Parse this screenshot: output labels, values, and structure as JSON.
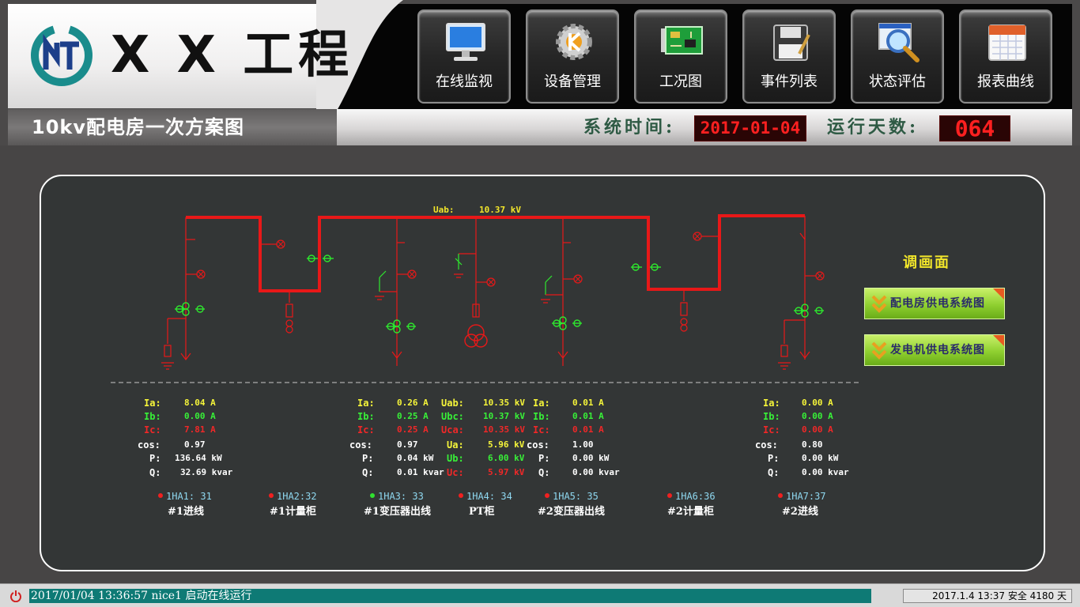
{
  "header": {
    "app_title": "X X 工程",
    "subtitle": "10kv配电房一次方案图",
    "system_time_label": "系统时间:",
    "system_time_value": "2017-01-04",
    "run_days_label": "运行天数:",
    "run_days_value": "064"
  },
  "nav": {
    "items": [
      {
        "label": "在线监视",
        "icon": "monitor-icon"
      },
      {
        "label": "设备管理",
        "icon": "gear-icon"
      },
      {
        "label": "工况图",
        "icon": "circuit-board-icon"
      },
      {
        "label": "事件列表",
        "icon": "floppy-disk-icon"
      },
      {
        "label": "状态评估",
        "icon": "magnifier-icon"
      },
      {
        "label": "报表曲线",
        "icon": "calendar-icon"
      }
    ]
  },
  "diagram": {
    "bus_label": "Uab:",
    "bus_value": "10.37 kV"
  },
  "feeders": [
    {
      "code": "1HA1: 31",
      "name": "#1进线",
      "status_color": "#f02020",
      "rows": [
        {
          "label": "Ia:",
          "value": "8.04 A",
          "color": "yellow"
        },
        {
          "label": "Ib:",
          "value": "0.00 A",
          "color": "green"
        },
        {
          "label": "Ic:",
          "value": "7.81 A",
          "color": "red"
        },
        {
          "label": "cos:",
          "value": "0.97",
          "color": "white"
        },
        {
          "label": "P:",
          "value": "136.64 kW",
          "color": "white"
        },
        {
          "label": "Q:",
          "value": "32.69 kvar",
          "color": "white"
        }
      ]
    },
    {
      "code": "1HA2:32",
      "name": "#1计量柜",
      "status_color": "#f02020",
      "rows": []
    },
    {
      "code": "1HA3: 33",
      "name": "#1变压器出线",
      "status_color": "#30e030",
      "rows": [
        {
          "label": "Ia:",
          "value": "0.26 A",
          "color": "yellow"
        },
        {
          "label": "Ib:",
          "value": "0.25 A",
          "color": "green"
        },
        {
          "label": "Ic:",
          "value": "0.25 A",
          "color": "red"
        },
        {
          "label": "cos:",
          "value": "0.97",
          "color": "white"
        },
        {
          "label": "P:",
          "value": "0.04 kW",
          "color": "white"
        },
        {
          "label": "Q:",
          "value": "0.01 kvar",
          "color": "white"
        }
      ]
    },
    {
      "code": "1HA4: 34",
      "name": "PT柜",
      "status_color": "#f02020",
      "rows": [
        {
          "label": "Uab:",
          "value": "10.35 kV",
          "color": "yellow"
        },
        {
          "label": "Ubc:",
          "value": "10.37 kV",
          "color": "green"
        },
        {
          "label": "Uca:",
          "value": "10.35 kV",
          "color": "red"
        },
        {
          "label": "Ua:",
          "value": "5.96 kV",
          "color": "yellow"
        },
        {
          "label": "Ub:",
          "value": "6.00 kV",
          "color": "green"
        },
        {
          "label": "Uc:",
          "value": "5.97 kV",
          "color": "red"
        }
      ]
    },
    {
      "code": "1HA5: 35",
      "name": "#2变压器出线",
      "status_color": "#f02020",
      "rows": [
        {
          "label": "Ia:",
          "value": "0.01 A",
          "color": "yellow"
        },
        {
          "label": "Ib:",
          "value": "0.01 A",
          "color": "green"
        },
        {
          "label": "Ic:",
          "value": "0.01 A",
          "color": "red"
        },
        {
          "label": "cos:",
          "value": "1.00",
          "color": "white"
        },
        {
          "label": "P:",
          "value": "0.00 kW",
          "color": "white"
        },
        {
          "label": "Q:",
          "value": "0.00 kvar",
          "color": "white"
        }
      ]
    },
    {
      "code": "1HA6:36",
      "name": "#2计量柜",
      "status_color": "#f02020",
      "rows": []
    },
    {
      "code": "1HA7:37",
      "name": "#2进线",
      "status_color": "#f02020",
      "rows": [
        {
          "label": "Ia:",
          "value": "0.00 A",
          "color": "yellow"
        },
        {
          "label": "Ib:",
          "value": "0.00 A",
          "color": "green"
        },
        {
          "label": "Ic:",
          "value": "0.00 A",
          "color": "red"
        },
        {
          "label": "cos:",
          "value": "0.80",
          "color": "white"
        },
        {
          "label": "P:",
          "value": "0.00 kW",
          "color": "white"
        },
        {
          "label": "Q:",
          "value": "0.00 kvar",
          "color": "white"
        }
      ]
    }
  ],
  "screen_switch": {
    "title": "调画面",
    "buttons": [
      {
        "label": "配电房供电系统图"
      },
      {
        "label": "发电机供电系统图"
      }
    ]
  },
  "status_bar": {
    "event_text": "2017/01/04 13:36:57 nice1 启动在线运行",
    "info_text": "2017.1.4   13:37 安全 4180 天"
  },
  "colors": {
    "bus": "#e81818",
    "equipment_green": "#2ee82e",
    "equipment_red": "#e81818",
    "label_yellow": "#f5f53a",
    "ticker_bg": "#0e7a75"
  }
}
